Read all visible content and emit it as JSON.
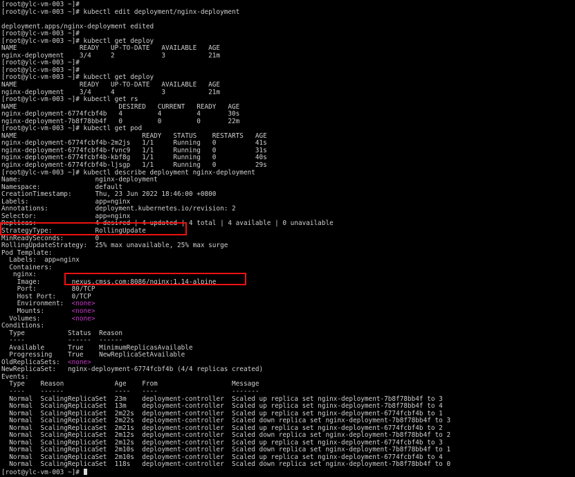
{
  "terminal": {
    "prompt": "[root@ylc-vm-003 ~]#",
    "cursor_visible": true,
    "colors": {
      "background": "#000000",
      "foreground": "#d0d0d0",
      "none_value": "#c838c8",
      "highlight_border": "#ee1111"
    },
    "highlights": [
      {
        "name": "strategy-type-highlight",
        "target": "StrategyType: RollingUpdate"
      },
      {
        "name": "image-highlight",
        "target": "nexus.cmss.com:8086/nginx:1.14-alpine"
      }
    ],
    "lines": [
      "[root@ylc-vm-003 ~]#",
      "[root@ylc-vm-003 ~]# kubectl edit deployment/nginx-deployment",
      "",
      "deployment.apps/nginx-deployment edited",
      "[root@ylc-vm-003 ~]#",
      "[root@ylc-vm-003 ~]# kubectl get deploy",
      "NAME                READY   UP-TO-DATE   AVAILABLE   AGE",
      "nginx-deployment    3/4     2            3           21m",
      "[root@ylc-vm-003 ~]#",
      "[root@ylc-vm-003 ~]#",
      "[root@ylc-vm-003 ~]# kubectl get deploy",
      "NAME                READY   UP-TO-DATE   AVAILABLE   AGE",
      "nginx-deployment    3/4     4            3           21m",
      "[root@ylc-vm-003 ~]# kubectl get rs",
      "NAME                          DESIRED   CURRENT   READY   AGE",
      "nginx-deployment-6774fcbf4b   4         4         4       30s",
      "nginx-deployment-7b8f78bb4f   0         0         0       22m",
      "[root@ylc-vm-003 ~]# kubectl get pod",
      "NAME                                READY   STATUS    RESTARTS   AGE",
      "nginx-deployment-6774fcbf4b-2m2js   1/1     Running   0          41s",
      "nginx-deployment-6774fcbf4b-fvnc9   1/1     Running   0          31s",
      "nginx-deployment-6774fcbf4b-kbf8g   1/1     Running   0          40s",
      "nginx-deployment-6774fcbf4b-ljsgp   1/1     Running   0          29s",
      "[root@ylc-vm-003 ~]# kubectl describe deployment nginx-deployment",
      "Name:                   nginx-deployment",
      "Namespace:              default",
      "CreationTimestamp:      Thu, 23 Jun 2022 18:46:00 +0800",
      "Labels:                 app=nginx",
      "Annotations:            deployment.kubernetes.io/revision: 2",
      "Selector:               app=nginx",
      "Replicas:               4 desired | 4 updated | 4 total | 4 available | 0 unavailable",
      "StrategyType:           RollingUpdate",
      "MinReadySeconds:        0",
      "RollingUpdateStrategy:  25% max unavailable, 25% max surge",
      "Pod Template:",
      "  Labels:  app=nginx",
      "  Containers:",
      "   nginx:",
      "    Image:        nexus.cmss.com:8086/nginx:1.14-alpine",
      "    Port:         80/TCP",
      "    Host Port:    0/TCP",
      "    Environment:  <none>",
      "    Mounts:       <none>",
      "  Volumes:        <none>",
      "Conditions:",
      "  Type           Status  Reason",
      "  ----           ------  ------",
      "  Available      True    MinimumReplicasAvailable",
      "  Progressing    True    NewReplicaSetAvailable",
      "OldReplicaSets:  <none>",
      "NewReplicaSet:   nginx-deployment-6774fcbf4b (4/4 replicas created)",
      "Events:",
      "  Type    Reason             Age    From                   Message",
      "  ----    ------             ----   ----                   -------",
      "  Normal  ScalingReplicaSet  23m    deployment-controller  Scaled up replica set nginx-deployment-7b8f78bb4f to 3",
      "  Normal  ScalingReplicaSet  13m    deployment-controller  Scaled up replica set nginx-deployment-7b8f78bb4f to 4",
      "  Normal  ScalingReplicaSet  2m22s  deployment-controller  Scaled up replica set nginx-deployment-6774fcbf4b to 1",
      "  Normal  ScalingReplicaSet  2m22s  deployment-controller  Scaled down replica set nginx-deployment-7b8f78bb4f to 3",
      "  Normal  ScalingReplicaSet  2m21s  deployment-controller  Scaled up replica set nginx-deployment-6774fcbf4b to 2",
      "  Normal  ScalingReplicaSet  2m12s  deployment-controller  Scaled down replica set nginx-deployment-7b8f78bb4f to 2",
      "  Normal  ScalingReplicaSet  2m12s  deployment-controller  Scaled up replica set nginx-deployment-6774fcbf4b to 3",
      "  Normal  ScalingReplicaSet  2m10s  deployment-controller  Scaled down replica set nginx-deployment-7b8f78bb4f to 1",
      "  Normal  ScalingReplicaSet  2m10s  deployment-controller  Scaled up replica set nginx-deployment-6774fcbf4b to 4",
      "  Normal  ScalingReplicaSet  118s   deployment-controller  Scaled down replica set nginx-deployment-7b8f78bb4f to 0",
      "[root@ylc-vm-003 ~]# "
    ]
  }
}
